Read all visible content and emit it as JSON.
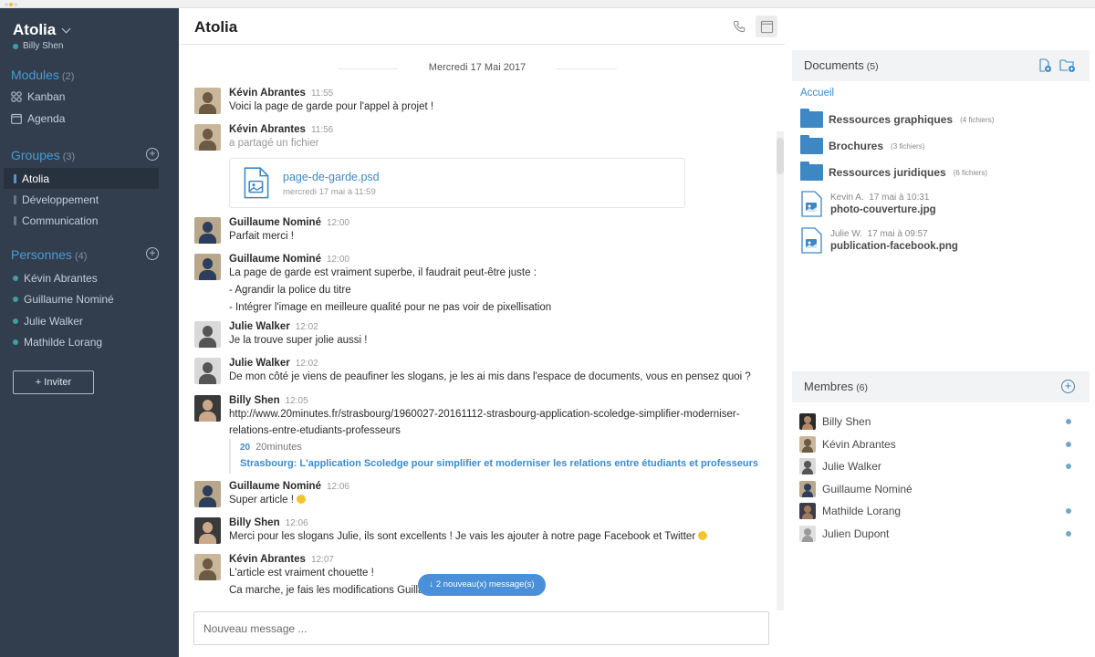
{
  "window": {
    "traffic_colors": [
      "#d8d8d8",
      "#f0b93a",
      "#d8d8d8"
    ]
  },
  "sidebar": {
    "workspace": "Atolia",
    "user": "Billy Shen",
    "modules": {
      "title": "Modules",
      "count": "(2)",
      "items": [
        {
          "label": "Kanban",
          "icon": "kanban-icon"
        },
        {
          "label": "Agenda",
          "icon": "calendar-icon"
        }
      ]
    },
    "groups": {
      "title": "Groupes",
      "count": "(3)",
      "items": [
        {
          "label": "Atolia",
          "active": true
        },
        {
          "label": "Développement"
        },
        {
          "label": "Communication"
        }
      ]
    },
    "people": {
      "title": "Personnes",
      "count": "(4)",
      "items": [
        {
          "label": "Kévin Abrantes"
        },
        {
          "label": "Guillaume Nominé"
        },
        {
          "label": "Julie Walker"
        },
        {
          "label": "Mathilde Lorang"
        }
      ]
    },
    "invite_label": "+ Inviter"
  },
  "main": {
    "title": "Atolia",
    "date_separator": "Mercredi 17 Mai 2017",
    "messages": [
      {
        "author": "Kévin Abrantes",
        "time": "11:55",
        "lines": [
          "Voici la page de garde pour l'appel à projet !"
        ]
      },
      {
        "author": "Kévin Abrantes",
        "time": "11:56",
        "lines": [
          "a partagé un fichier"
        ],
        "file": {
          "name": "page-de-garde.psd",
          "date": "mercredi 17 mai à 11:59"
        }
      },
      {
        "author": "Guillaume Nominé",
        "time": "12:00",
        "lines": [
          "Parfait merci !"
        ]
      },
      {
        "author": "Guillaume Nominé",
        "time": "12:00",
        "lines": [
          "La page de garde est vraiment superbe, il faudrait peut-être juste :",
          "- Agrandir la police du titre",
          "- Intégrer l'image en meilleure qualité pour ne pas voir de pixellisation"
        ]
      },
      {
        "author": "Julie Walker",
        "time": "12:02",
        "lines": [
          "Je la trouve super jolie aussi !"
        ]
      },
      {
        "author": "Julie Walker",
        "time": "12:02",
        "lines": [
          "De mon côté je viens de peaufiner les slogans, je les ai mis dans l'espace de documents, vous en pensez quoi ?"
        ]
      },
      {
        "author": "Billy Shen",
        "time": "12:05",
        "lines": [
          "http://www.20minutes.fr/strasbourg/1960027-20161112-strasbourg-application-scoledge-simplifier-moderniser-",
          "relations-entre-etudiants-professeurs"
        ],
        "preview": {
          "source": "20minutes",
          "title": "Strasbourg: L'application Scoledge pour simplifier et moderniser les relations entre étudiants et professeurs"
        }
      },
      {
        "author": "Guillaume Nominé",
        "time": "12:06",
        "lines": [
          "Super article !"
        ],
        "emoji": "grinning-emoji"
      },
      {
        "author": "Billy Shen",
        "time": "12:06",
        "lines": [
          "Merci pour les slogans Julie, ils sont excellents ! Je vais les ajouter à notre page Facebook et Twitter"
        ],
        "emoji": "smile-emoji"
      },
      {
        "author": "Kévin Abrantes",
        "time": "12:07",
        "lines": [
          "L'article est vraiment chouette !",
          "Ca marche, je fais les modifications Guillaume"
        ]
      }
    ],
    "new_messages_label": "↓ 2 nouveau(x) message(s)",
    "composer_placeholder": "Nouveau message ..."
  },
  "documents": {
    "title": "Documents",
    "count": "(5)",
    "breadcrumb": "Accueil",
    "folders": [
      {
        "name": "Ressources graphiques",
        "count": "(4 fichiers)"
      },
      {
        "name": "Brochures",
        "count": "(3 fichiers)"
      },
      {
        "name": "Ressources juridiques",
        "count": "(6 fichiers)"
      }
    ],
    "files": [
      {
        "author": "Kevin A.",
        "date": "17 mai à 10:31",
        "name": "photo-couverture.jpg"
      },
      {
        "author": "Julie W.",
        "date": "17 mai à 09:57",
        "name": "publication-facebook.png"
      }
    ]
  },
  "members": {
    "title": "Membres",
    "count": "(6)",
    "items": [
      {
        "name": "Billy Shen",
        "online": true
      },
      {
        "name": "Kévin Abrantes",
        "online": true
      },
      {
        "name": "Julie Walker",
        "online": true
      },
      {
        "name": "Guillaume Nominé",
        "online": false
      },
      {
        "name": "Mathilde Lorang",
        "online": true
      },
      {
        "name": "Julien Dupont",
        "online": true
      }
    ]
  },
  "colors": {
    "sidebar_bg": "#323e4e",
    "accent": "#3b8bcb",
    "online": "#3e9ea0"
  }
}
